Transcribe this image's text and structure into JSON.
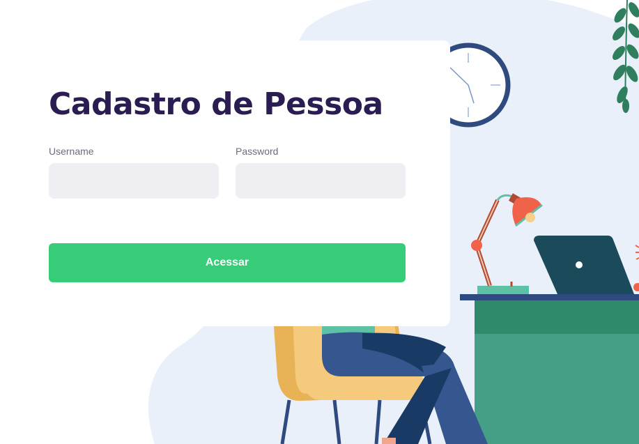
{
  "form": {
    "title": "Cadastro de Pessoa",
    "username": {
      "label": "Username",
      "value": "",
      "placeholder": ""
    },
    "password": {
      "label": "Password",
      "value": "",
      "placeholder": ""
    },
    "submit_label": "Acessar"
  },
  "colors": {
    "title": "#2b1d52",
    "button": "#36cc78",
    "input_background": "#efeff3",
    "background_blob": "#e9f0f9",
    "desk": "#459e86"
  },
  "illustration": {
    "scene": "office-desk",
    "icons": [
      "wall-clock-icon",
      "hanging-plant-icon",
      "desk-lamp-icon",
      "laptop-icon",
      "chair-icon",
      "person-icon"
    ]
  }
}
